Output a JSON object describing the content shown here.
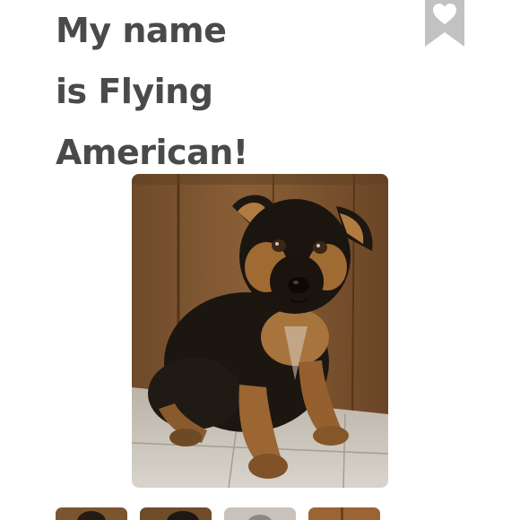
{
  "pet": {
    "title_lines": [
      "My name",
      "is Flying",
      "American!"
    ]
  },
  "favorite": {
    "icon": "heart-bookmark-icon",
    "color": "#c2c2c2"
  },
  "gallery": {
    "thumbnail_count": 4
  },
  "colors": {
    "title_text": "#4a4a4a",
    "background": "#ffffff"
  }
}
